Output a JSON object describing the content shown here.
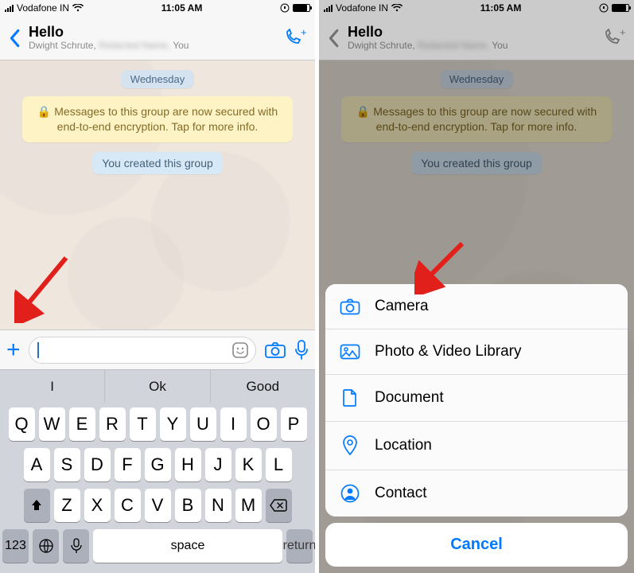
{
  "status": {
    "carrier": "Vodafone IN",
    "time": "11:05 AM"
  },
  "chat": {
    "title": "Hello",
    "subtitle_prefix": "Dwight Schrute, ",
    "subtitle_suffix": " You",
    "date": "Wednesday",
    "encryption": "Messages to this group are now secured with end-to-end encryption. Tap for more info.",
    "created": "You created this group"
  },
  "quicktype": {
    "s1": "I",
    "s2": "Ok",
    "s3": "Good"
  },
  "keyboard": {
    "k123": "123",
    "space": "space",
    "return": "return"
  },
  "sheet": {
    "camera": "Camera",
    "photo": "Photo & Video Library",
    "document": "Document",
    "location": "Location",
    "contact": "Contact",
    "cancel": "Cancel"
  }
}
